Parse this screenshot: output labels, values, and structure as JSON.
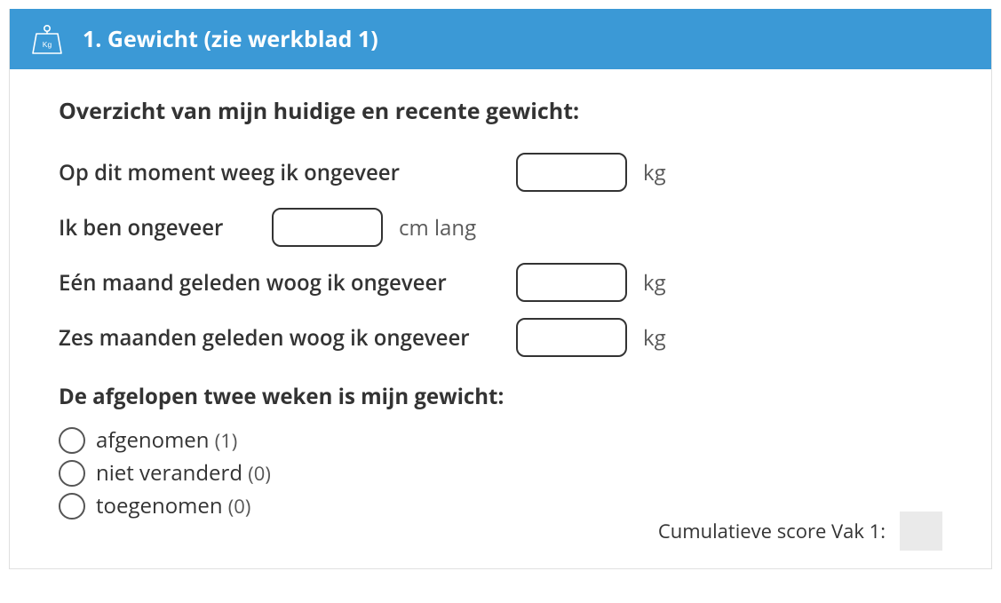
{
  "header": {
    "title": "1. Gewicht (zie werkblad 1)",
    "icon": "weight-kg-icon",
    "icon_text": "Kg"
  },
  "intro": "Overzicht van mijn huidige en recente gewicht:",
  "rows": {
    "current_weight": {
      "label": "Op dit moment weeg ik ongeveer",
      "value": "",
      "unit": "kg"
    },
    "height": {
      "label": "Ik ben ongeveer",
      "value": "",
      "unit": "cm lang"
    },
    "one_month": {
      "label": "Eén maand geleden woog ik ongeveer",
      "value": "",
      "unit": "kg"
    },
    "six_months": {
      "label": "Zes maanden geleden woog ik ongeveer",
      "value": "",
      "unit": "kg"
    }
  },
  "sub_question": "De afgelopen twee weken is mijn gewicht:",
  "options": [
    {
      "label": "afgenomen",
      "score": "(1)"
    },
    {
      "label": "niet veranderd",
      "score": "(0)"
    },
    {
      "label": "toegenomen",
      "score": "(0)"
    }
  ],
  "footer": {
    "label": "Cumulatieve score Vak 1:",
    "value": ""
  }
}
